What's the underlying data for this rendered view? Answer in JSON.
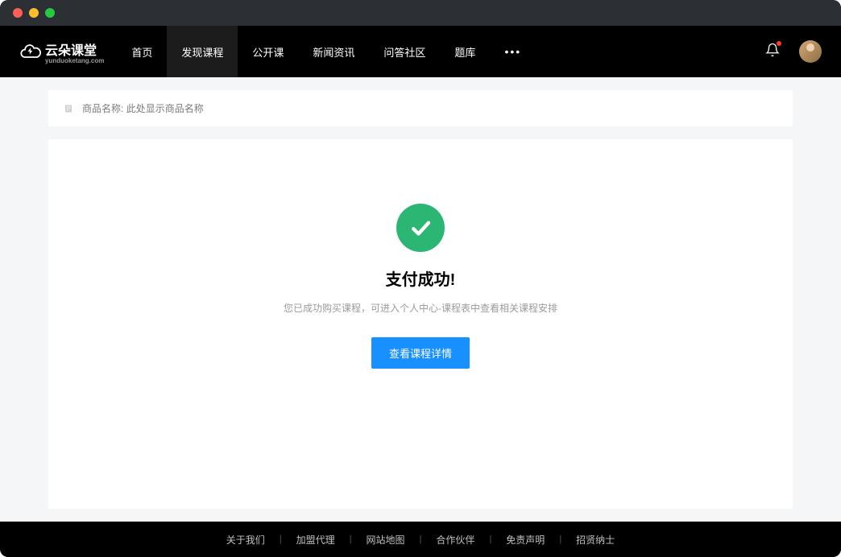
{
  "logo": {
    "text": "云朵课堂",
    "sub": "yunduoketang.com"
  },
  "nav": {
    "items": [
      {
        "label": "首页",
        "active": false
      },
      {
        "label": "发现课程",
        "active": true
      },
      {
        "label": "公开课",
        "active": false
      },
      {
        "label": "新闻资讯",
        "active": false
      },
      {
        "label": "问答社区",
        "active": false
      },
      {
        "label": "题库",
        "active": false
      }
    ],
    "more": "•••"
  },
  "product": {
    "label": "商品名称:",
    "value": "此处显示商品名称"
  },
  "success": {
    "title": "支付成功!",
    "desc": "您已成功购买课程，可进入个人中心-课程表中查看相关课程安排",
    "button": "查看课程详情"
  },
  "footer": {
    "links": [
      "关于我们",
      "加盟代理",
      "网站地图",
      "合作伙伴",
      "免责声明",
      "招贤纳士"
    ]
  }
}
